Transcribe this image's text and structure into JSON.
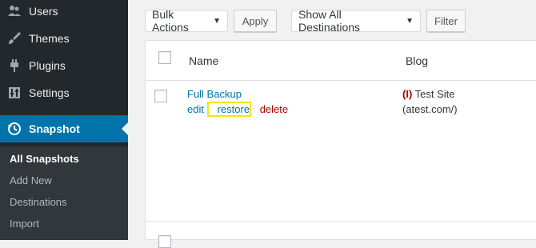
{
  "sidebar": {
    "items": [
      {
        "label": "Users",
        "icon": "users-icon"
      },
      {
        "label": "Themes",
        "icon": "brush-icon"
      },
      {
        "label": "Plugins",
        "icon": "plugin-icon"
      },
      {
        "label": "Settings",
        "icon": "settings-icon"
      },
      {
        "label": "Snapshot",
        "icon": "history-icon"
      }
    ],
    "submenu": [
      "All Snapshots",
      "Add New",
      "Destinations",
      "Import"
    ]
  },
  "toolbar": {
    "bulk_actions": "Bulk Actions",
    "apply": "Apply",
    "destinations": "Show All Destinations",
    "filter": "Filter"
  },
  "table": {
    "headers": {
      "name": "Name",
      "blog": "Blog"
    },
    "rows": [
      {
        "name": "Full Backup",
        "actions": {
          "edit": "edit",
          "restore": "restore",
          "delete": "delete"
        },
        "blog_prefix": "(I)",
        "blog_name": "Test Site",
        "blog_url": "(atest.com/)"
      }
    ]
  },
  "colors": {
    "sidebar_bg": "#23282d",
    "active_bg": "#0073aa",
    "link": "#0073aa",
    "delete": "#aa0000",
    "highlight": "#f5e60a"
  }
}
